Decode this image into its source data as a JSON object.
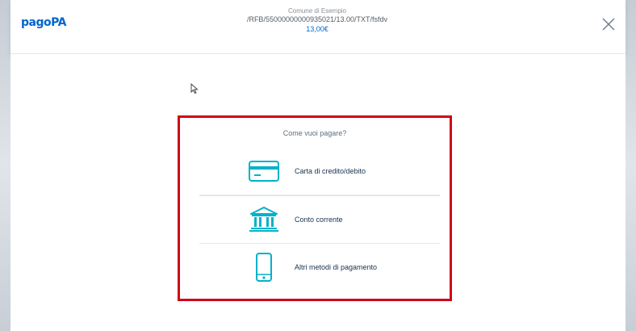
{
  "header": {
    "logo_text": "pagoPA",
    "merchant": "Comune di Esempio",
    "reference": "/RFB/55000000000935021/13.00/TXT/fsfdv",
    "amount": "13,00€"
  },
  "main": {
    "question": "Come vuoi pagare?",
    "methods": [
      {
        "label": "Carta di credito/debito",
        "icon": "credit-card-icon"
      },
      {
        "label": "Conto corrente",
        "icon": "bank-icon"
      },
      {
        "label": "Altri metodi di pagamento",
        "icon": "mobile-phone-icon"
      }
    ]
  },
  "colors": {
    "brand_blue": "#0066cc",
    "icon_teal": "#00b2c8",
    "highlight_red": "#d0021b"
  }
}
